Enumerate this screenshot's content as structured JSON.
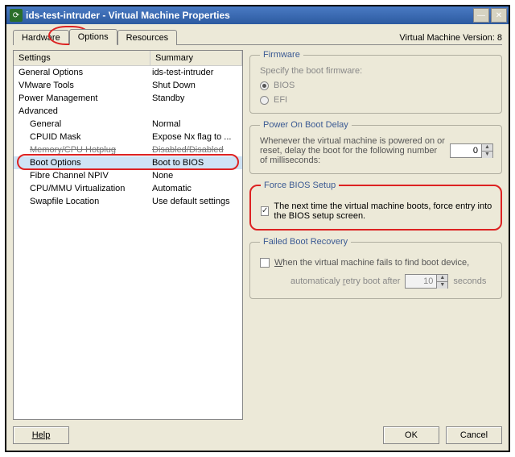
{
  "window": {
    "title": "ids-test-intruder - Virtual Machine Properties"
  },
  "tabs": {
    "hardware": "Hardware",
    "options": "Options",
    "resources": "Resources"
  },
  "vm_version_label": "Virtual Machine Version: 8",
  "left": {
    "hdr_settings": "Settings",
    "hdr_summary": "Summary",
    "rows": [
      {
        "label": "General Options",
        "summary": "ids-test-intruder",
        "indent": false
      },
      {
        "label": "VMware Tools",
        "summary": "Shut Down",
        "indent": false
      },
      {
        "label": "Power Management",
        "summary": "Standby",
        "indent": false
      },
      {
        "label": "Advanced",
        "summary": "",
        "indent": false
      },
      {
        "label": "General",
        "summary": "Normal",
        "indent": true
      },
      {
        "label": "CPUID Mask",
        "summary": "Expose Nx flag to ...",
        "indent": true
      },
      {
        "label": "Memory/CPU Hotplug",
        "summary": "Disabled/Disabled",
        "indent": true,
        "strike": true
      },
      {
        "label": "Boot Options",
        "summary": "Boot to BIOS",
        "indent": true,
        "sel": true
      },
      {
        "label": "Fibre Channel NPIV",
        "summary": "None",
        "indent": true
      },
      {
        "label": "CPU/MMU Virtualization",
        "summary": "Automatic",
        "indent": true
      },
      {
        "label": "Swapfile Location",
        "summary": "Use default settings",
        "indent": true
      }
    ]
  },
  "firmware": {
    "legend": "Firmware",
    "text": "Specify the boot firmware:",
    "bios": "BIOS",
    "efi": "EFI"
  },
  "bootdelay": {
    "legend": "Power On Boot Delay",
    "text": "Whenever the virtual machine is powered on or reset, delay the boot for the following number of milliseconds:",
    "value": "0"
  },
  "force": {
    "legend": "Force BIOS Setup",
    "text": "The next time the virtual machine boots, force entry into the BIOS setup screen."
  },
  "failed": {
    "legend": "Failed Boot Recovery",
    "chk_pre": "W",
    "chk_text": "hen the virtual machine fails to find boot device,",
    "line2_a": "automaticaly ",
    "line2_r": "r",
    "line2_b": "etry boot after",
    "value": "10",
    "seconds": "seconds"
  },
  "buttons": {
    "help": "Help",
    "ok": "OK",
    "cancel": "Cancel"
  }
}
